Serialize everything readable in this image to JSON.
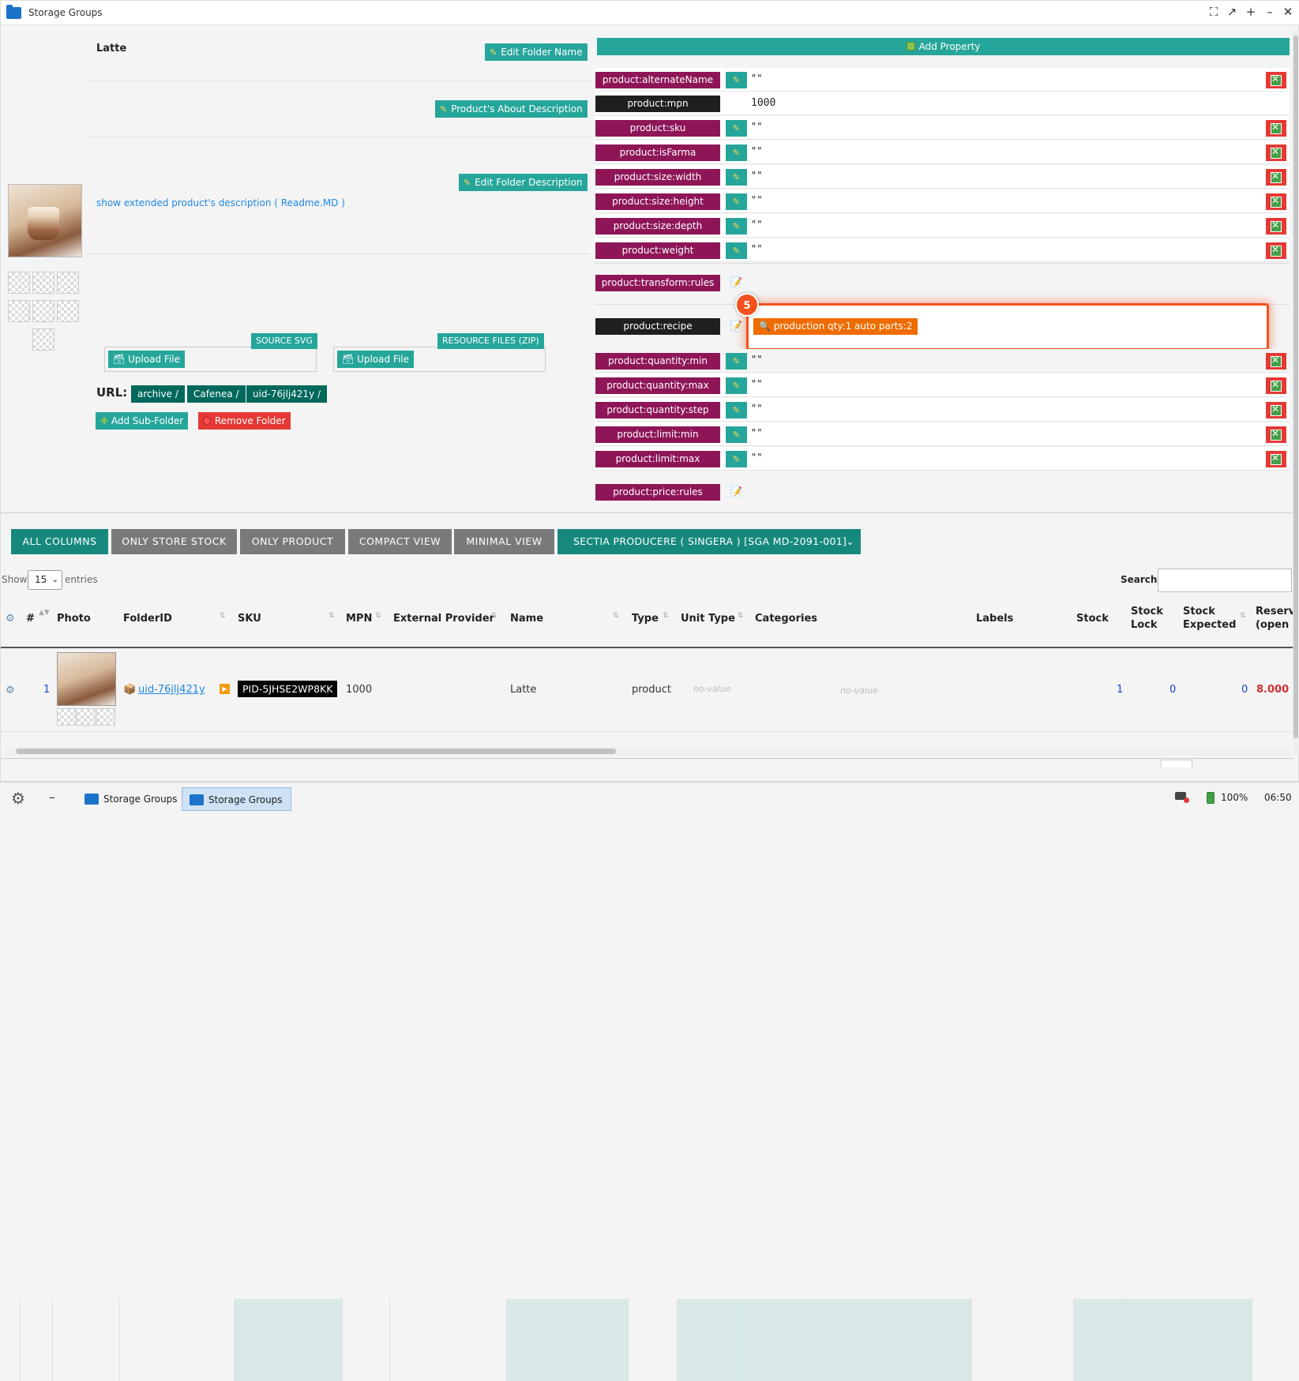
{
  "window": {
    "title": "Storage Groups",
    "controls": [
      "⛶",
      "↗",
      "+",
      "–",
      "✕"
    ]
  },
  "folder": {
    "name": "Latte",
    "edit_name_label": "Edit Folder Name",
    "about_label": "Product's About Description",
    "edit_desc_label": "Edit Folder Description",
    "readme_link": "show extended product's description ( Readme.MD )"
  },
  "uploads": {
    "svg_tag": "SOURCE SVG",
    "svg_btn": "Upload File",
    "zip_tag": "RESOURCE FILES (ZIP)",
    "zip_btn": "Upload File"
  },
  "url": {
    "label": "URL:",
    "crumbs": [
      "archive /",
      "Cafenea /",
      "uid-76jlj421y /"
    ]
  },
  "actions": {
    "add_sub": "Add Sub-Folder",
    "remove": "Remove Folder"
  },
  "props": {
    "add_label": "Add Property",
    "rows": [
      {
        "key": "product:alternateName",
        "val": "\"\""
      },
      {
        "key": "product:mpn",
        "val": "1000"
      },
      {
        "key": "product:sku",
        "val": "\"\""
      },
      {
        "key": "product:isFarma",
        "val": "\"\""
      },
      {
        "key": "product:size:width",
        "val": "\"\""
      },
      {
        "key": "product:size:height",
        "val": "\"\""
      },
      {
        "key": "product:size:depth",
        "val": "\"\""
      },
      {
        "key": "product:weight",
        "val": "\"\""
      },
      {
        "key": "product:transform:rules",
        "val": ""
      },
      {
        "key": "product:recipe",
        "val": "production qty:1 auto parts:2"
      },
      {
        "key": "product:quantity:min",
        "val": "\"\""
      },
      {
        "key": "product:quantity:max",
        "val": "\"\""
      },
      {
        "key": "product:quantity:step",
        "val": "\"\""
      },
      {
        "key": "product:limit:min",
        "val": "\"\""
      },
      {
        "key": "product:limit:max",
        "val": "\"\""
      },
      {
        "key": "product:price:rules",
        "val": ""
      }
    ],
    "highlight_badge": "5"
  },
  "views": [
    "ALL COLUMNS",
    "ONLY STORE STOCK",
    "ONLY PRODUCT",
    "COMPACT VIEW",
    "MINIMAL VIEW"
  ],
  "section_select": "SECTIA PRODUCERE ( SINGERA ) [SGA MD-2091-001]",
  "table": {
    "show": "Show",
    "page_size": "15",
    "entries": "entries",
    "search": "Search:",
    "headers": [
      "#",
      "Photo",
      "FolderID",
      "SKU",
      "MPN",
      "External Provider",
      "Name",
      "Type",
      "Unit Type",
      "Categories",
      "Labels",
      "Stock",
      "Stock Lock",
      "Stock Expected",
      "Reserv (open"
    ],
    "row": {
      "num": "1",
      "folder_id": "uid-76jlj421y",
      "sku": "PID-5JHSE2WP8KK",
      "mpn": "1000",
      "name": "Latte",
      "type": "product",
      "unit_type": "no-value",
      "categories": "no-value",
      "stock": "1",
      "stock_lock": "0",
      "stock_expected": "0",
      "reserved": "8.000"
    }
  },
  "taskbar": {
    "items": [
      "Storage Groups",
      "Storage Groups"
    ],
    "battery": "100%",
    "time": "06:50"
  }
}
